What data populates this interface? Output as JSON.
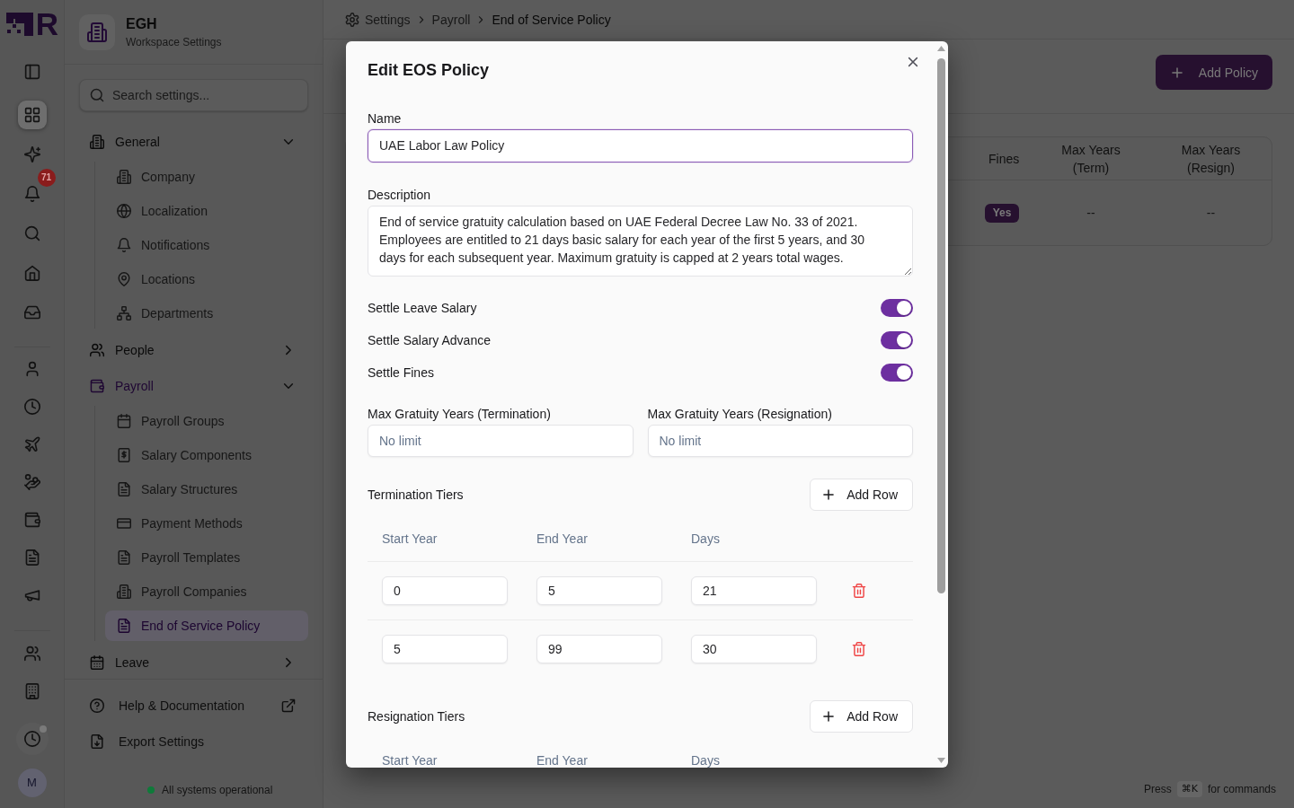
{
  "rail": {
    "logo_letter": "R",
    "groups": [
      [
        {
          "selected": true
        },
        {
          "selected": false
        },
        {
          "selected": false,
          "badge": "71"
        },
        {
          "selected": false
        },
        {
          "selected": false
        },
        {
          "selected": false
        }
      ],
      [
        {
          "selected": false
        },
        {
          "selected": false
        },
        {
          "selected": false
        },
        {
          "selected": false
        },
        {
          "selected": false
        },
        {
          "selected": false
        },
        {
          "selected": false
        }
      ],
      [
        {
          "selected": false
        },
        {
          "selected": false
        }
      ]
    ],
    "bottom_item": {
      "selected": false,
      "indicator": true
    },
    "avatar": "M"
  },
  "sidebar": {
    "workspace": {
      "name": "EGH",
      "subtitle": "Workspace Settings"
    },
    "search": {
      "placeholder": "Search settings..."
    },
    "sections": [
      {
        "label": "General",
        "expanded": true,
        "children": [
          {
            "label": "Company",
            "selected": false
          },
          {
            "label": "Localization",
            "selected": false
          },
          {
            "label": "Notifications",
            "selected": false
          },
          {
            "label": "Locations",
            "selected": false
          },
          {
            "label": "Departments",
            "selected": false
          }
        ]
      },
      {
        "label": "People",
        "expanded": false
      },
      {
        "label": "Payroll",
        "expanded": true,
        "children": [
          {
            "label": "Payroll Groups",
            "selected": false
          },
          {
            "label": "Salary Components",
            "selected": false
          },
          {
            "label": "Salary Structures",
            "selected": false
          },
          {
            "label": "Payment Methods",
            "selected": false
          },
          {
            "label": "Payroll Templates",
            "selected": false
          },
          {
            "label": "Payroll Companies",
            "selected": false
          },
          {
            "label": "End of Service Policy",
            "selected": true
          }
        ]
      },
      {
        "label": "Leave",
        "expanded": false
      }
    ],
    "links": [
      {
        "label": "Help & Documentation",
        "external": true
      },
      {
        "label": "Export Settings",
        "external": false
      }
    ],
    "status": {
      "text": "All systems operational",
      "ok": true
    }
  },
  "main": {
    "breadcrumb": [
      {
        "label": "Settings",
        "current": false
      },
      {
        "label": "Payroll",
        "current": false
      },
      {
        "label": "End of Service Policy",
        "current": true
      }
    ],
    "add_button": {
      "label": "Add Policy"
    },
    "table": {
      "columns": [
        "Fines",
        "Max Years (Term)",
        "Max Years (Resign)"
      ],
      "rows": [
        {
          "cells": [
            {
              "kind": "badge",
              "text": "Yes"
            },
            {
              "kind": "text",
              "text": "--"
            },
            {
              "kind": "text",
              "text": "--"
            }
          ]
        }
      ]
    },
    "command_hint": {
      "prefix": "Press",
      "key": "⌘K",
      "suffix": "for commands"
    }
  },
  "modal": {
    "title": "Edit EOS Policy",
    "name_field": {
      "label": "Name",
      "value": "UAE Labor Law Policy",
      "focused": true
    },
    "description_field": {
      "label": "Description",
      "value": "End of service gratuity calculation based on UAE Federal Decree Law No. 33 of 2021. Employees are entitled to 21 days basic salary for each year of the first 5 years, and 30 days for each subsequent year. Maximum gratuity is capped at 2 years total wages."
    },
    "toggles": [
      {
        "label": "Settle Leave Salary",
        "on": true
      },
      {
        "label": "Settle Salary Advance",
        "on": true
      },
      {
        "label": "Settle Fines",
        "on": true
      }
    ],
    "limit_fields": [
      {
        "label": "Max Gratuity Years (Termination)",
        "placeholder": "No limit"
      },
      {
        "label": "Max Gratuity Years (Resignation)",
        "placeholder": "No limit"
      }
    ],
    "tier_sections": [
      {
        "title": "Termination Tiers",
        "add_button": "Add Row",
        "columns": [
          "Start Year",
          "End Year",
          "Days"
        ],
        "rows": [
          {
            "cells": [
              "0",
              "5",
              "21"
            ]
          },
          {
            "cells": [
              "5",
              "99",
              "30"
            ]
          }
        ]
      },
      {
        "title": "Resignation Tiers",
        "add_button": "Add Row",
        "columns": [
          "Start Year",
          "End Year",
          "Days"
        ]
      }
    ]
  }
}
